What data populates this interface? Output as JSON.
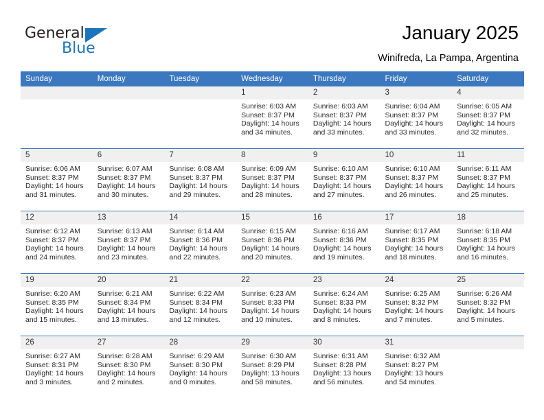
{
  "brand": {
    "name_part1": "General",
    "name_part2": "Blue",
    "flag_icon": "blue-triangle-flag",
    "accent_color": "#1b75bb"
  },
  "header": {
    "title": "January 2025",
    "subtitle": "Winifreda, La Pampa, Argentina"
  },
  "calendar": {
    "header_bg": "#3b78bf",
    "daynum_bg": "#f0f0f0",
    "weekdays": [
      "Sunday",
      "Monday",
      "Tuesday",
      "Wednesday",
      "Thursday",
      "Friday",
      "Saturday"
    ],
    "weeks": [
      [
        {
          "day": "",
          "empty": true
        },
        {
          "day": "",
          "empty": true
        },
        {
          "day": "",
          "empty": true
        },
        {
          "day": "1",
          "sunrise": "Sunrise: 6:03 AM",
          "sunset": "Sunset: 8:37 PM",
          "daylight_line1": "Daylight: 14 hours",
          "daylight_line2": "and 34 minutes."
        },
        {
          "day": "2",
          "sunrise": "Sunrise: 6:03 AM",
          "sunset": "Sunset: 8:37 PM",
          "daylight_line1": "Daylight: 14 hours",
          "daylight_line2": "and 33 minutes."
        },
        {
          "day": "3",
          "sunrise": "Sunrise: 6:04 AM",
          "sunset": "Sunset: 8:37 PM",
          "daylight_line1": "Daylight: 14 hours",
          "daylight_line2": "and 33 minutes."
        },
        {
          "day": "4",
          "sunrise": "Sunrise: 6:05 AM",
          "sunset": "Sunset: 8:37 PM",
          "daylight_line1": "Daylight: 14 hours",
          "daylight_line2": "and 32 minutes."
        }
      ],
      [
        {
          "day": "5",
          "sunrise": "Sunrise: 6:06 AM",
          "sunset": "Sunset: 8:37 PM",
          "daylight_line1": "Daylight: 14 hours",
          "daylight_line2": "and 31 minutes."
        },
        {
          "day": "6",
          "sunrise": "Sunrise: 6:07 AM",
          "sunset": "Sunset: 8:37 PM",
          "daylight_line1": "Daylight: 14 hours",
          "daylight_line2": "and 30 minutes."
        },
        {
          "day": "7",
          "sunrise": "Sunrise: 6:08 AM",
          "sunset": "Sunset: 8:37 PM",
          "daylight_line1": "Daylight: 14 hours",
          "daylight_line2": "and 29 minutes."
        },
        {
          "day": "8",
          "sunrise": "Sunrise: 6:09 AM",
          "sunset": "Sunset: 8:37 PM",
          "daylight_line1": "Daylight: 14 hours",
          "daylight_line2": "and 28 minutes."
        },
        {
          "day": "9",
          "sunrise": "Sunrise: 6:10 AM",
          "sunset": "Sunset: 8:37 PM",
          "daylight_line1": "Daylight: 14 hours",
          "daylight_line2": "and 27 minutes."
        },
        {
          "day": "10",
          "sunrise": "Sunrise: 6:10 AM",
          "sunset": "Sunset: 8:37 PM",
          "daylight_line1": "Daylight: 14 hours",
          "daylight_line2": "and 26 minutes."
        },
        {
          "day": "11",
          "sunrise": "Sunrise: 6:11 AM",
          "sunset": "Sunset: 8:37 PM",
          "daylight_line1": "Daylight: 14 hours",
          "daylight_line2": "and 25 minutes."
        }
      ],
      [
        {
          "day": "12",
          "sunrise": "Sunrise: 6:12 AM",
          "sunset": "Sunset: 8:37 PM",
          "daylight_line1": "Daylight: 14 hours",
          "daylight_line2": "and 24 minutes."
        },
        {
          "day": "13",
          "sunrise": "Sunrise: 6:13 AM",
          "sunset": "Sunset: 8:37 PM",
          "daylight_line1": "Daylight: 14 hours",
          "daylight_line2": "and 23 minutes."
        },
        {
          "day": "14",
          "sunrise": "Sunrise: 6:14 AM",
          "sunset": "Sunset: 8:36 PM",
          "daylight_line1": "Daylight: 14 hours",
          "daylight_line2": "and 22 minutes."
        },
        {
          "day": "15",
          "sunrise": "Sunrise: 6:15 AM",
          "sunset": "Sunset: 8:36 PM",
          "daylight_line1": "Daylight: 14 hours",
          "daylight_line2": "and 20 minutes."
        },
        {
          "day": "16",
          "sunrise": "Sunrise: 6:16 AM",
          "sunset": "Sunset: 8:36 PM",
          "daylight_line1": "Daylight: 14 hours",
          "daylight_line2": "and 19 minutes."
        },
        {
          "day": "17",
          "sunrise": "Sunrise: 6:17 AM",
          "sunset": "Sunset: 8:35 PM",
          "daylight_line1": "Daylight: 14 hours",
          "daylight_line2": "and 18 minutes."
        },
        {
          "day": "18",
          "sunrise": "Sunrise: 6:18 AM",
          "sunset": "Sunset: 8:35 PM",
          "daylight_line1": "Daylight: 14 hours",
          "daylight_line2": "and 16 minutes."
        }
      ],
      [
        {
          "day": "19",
          "sunrise": "Sunrise: 6:20 AM",
          "sunset": "Sunset: 8:35 PM",
          "daylight_line1": "Daylight: 14 hours",
          "daylight_line2": "and 15 minutes."
        },
        {
          "day": "20",
          "sunrise": "Sunrise: 6:21 AM",
          "sunset": "Sunset: 8:34 PM",
          "daylight_line1": "Daylight: 14 hours",
          "daylight_line2": "and 13 minutes."
        },
        {
          "day": "21",
          "sunrise": "Sunrise: 6:22 AM",
          "sunset": "Sunset: 8:34 PM",
          "daylight_line1": "Daylight: 14 hours",
          "daylight_line2": "and 12 minutes."
        },
        {
          "day": "22",
          "sunrise": "Sunrise: 6:23 AM",
          "sunset": "Sunset: 8:33 PM",
          "daylight_line1": "Daylight: 14 hours",
          "daylight_line2": "and 10 minutes."
        },
        {
          "day": "23",
          "sunrise": "Sunrise: 6:24 AM",
          "sunset": "Sunset: 8:33 PM",
          "daylight_line1": "Daylight: 14 hours",
          "daylight_line2": "and 8 minutes."
        },
        {
          "day": "24",
          "sunrise": "Sunrise: 6:25 AM",
          "sunset": "Sunset: 8:32 PM",
          "daylight_line1": "Daylight: 14 hours",
          "daylight_line2": "and 7 minutes."
        },
        {
          "day": "25",
          "sunrise": "Sunrise: 6:26 AM",
          "sunset": "Sunset: 8:32 PM",
          "daylight_line1": "Daylight: 14 hours",
          "daylight_line2": "and 5 minutes."
        }
      ],
      [
        {
          "day": "26",
          "sunrise": "Sunrise: 6:27 AM",
          "sunset": "Sunset: 8:31 PM",
          "daylight_line1": "Daylight: 14 hours",
          "daylight_line2": "and 3 minutes."
        },
        {
          "day": "27",
          "sunrise": "Sunrise: 6:28 AM",
          "sunset": "Sunset: 8:30 PM",
          "daylight_line1": "Daylight: 14 hours",
          "daylight_line2": "and 2 minutes."
        },
        {
          "day": "28",
          "sunrise": "Sunrise: 6:29 AM",
          "sunset": "Sunset: 8:30 PM",
          "daylight_line1": "Daylight: 14 hours",
          "daylight_line2": "and 0 minutes."
        },
        {
          "day": "29",
          "sunrise": "Sunrise: 6:30 AM",
          "sunset": "Sunset: 8:29 PM",
          "daylight_line1": "Daylight: 13 hours",
          "daylight_line2": "and 58 minutes."
        },
        {
          "day": "30",
          "sunrise": "Sunrise: 6:31 AM",
          "sunset": "Sunset: 8:28 PM",
          "daylight_line1": "Daylight: 13 hours",
          "daylight_line2": "and 56 minutes."
        },
        {
          "day": "31",
          "sunrise": "Sunrise: 6:32 AM",
          "sunset": "Sunset: 8:27 PM",
          "daylight_line1": "Daylight: 13 hours",
          "daylight_line2": "and 54 minutes."
        },
        {
          "day": "",
          "empty": true
        }
      ]
    ]
  }
}
